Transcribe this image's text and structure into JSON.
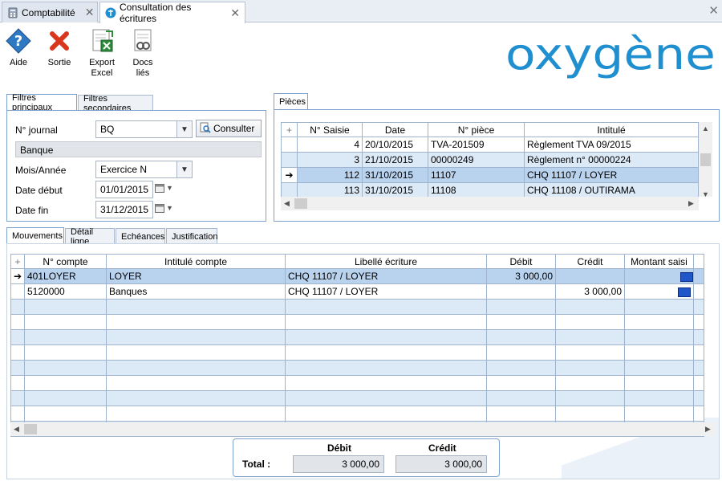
{
  "window_tabs": [
    {
      "label": "Comptabilité",
      "active": false
    },
    {
      "label": "Consultation des écritures",
      "active": true
    }
  ],
  "toolbar": {
    "aide": "Aide",
    "sortie": "Sortie",
    "export_line1": "Export",
    "export_line2": "Excel",
    "docs_line1": "Docs",
    "docs_line2": "liés"
  },
  "logo_text": "oxygène",
  "filters": {
    "tab_main": "Filtres principaux",
    "tab_secondary": "Filtres secondaires",
    "journal_label": "N° journal",
    "journal_value": "BQ",
    "consult_button": "Consulter",
    "journal_name": "Banque",
    "period_label": "Mois/Année",
    "period_value": "Exercice N",
    "start_label": "Date début",
    "start_value": "01/01/2015",
    "end_label": "Date fin",
    "end_value": "31/12/2015"
  },
  "pieces": {
    "tab": "Pièces",
    "headers": [
      "N° Saisie",
      "Date",
      "N° pièce",
      "Intitulé"
    ],
    "rows": [
      {
        "saisie": "4",
        "date": "20/10/2015",
        "piece": "TVA-201509",
        "intitule": "Règlement TVA 09/2015"
      },
      {
        "saisie": "3",
        "date": "21/10/2015",
        "piece": "00000249",
        "intitule": "Règlement n° 00000224"
      },
      {
        "saisie": "112",
        "date": "31/10/2015",
        "piece": "11107",
        "intitule": "CHQ 11107 / LOYER"
      },
      {
        "saisie": "113",
        "date": "31/10/2015",
        "piece": "11108",
        "intitule": "CHQ 11108 / OUTIRAMA"
      }
    ]
  },
  "lower_tabs": [
    "Mouvements",
    "Détail ligne",
    "Echéances",
    "Justification"
  ],
  "mouvements": {
    "headers": [
      "N° compte",
      "Intitulé compte",
      "Libellé écriture",
      "Débit",
      "Crédit",
      "Montant saisi"
    ],
    "rows": [
      {
        "compte": "401LOYER",
        "intitule": "LOYER",
        "libelle": "CHQ 11107 / LOYER",
        "debit": "3 000,00",
        "credit": ""
      },
      {
        "compte": "5120000",
        "intitule": "Banques",
        "libelle": "CHQ 11107 / LOYER",
        "debit": "",
        "credit": "3 000,00"
      }
    ]
  },
  "totals": {
    "debit_header": "Débit",
    "credit_header": "Crédit",
    "label": "Total :",
    "debit": "3 000,00",
    "credit": "3 000,00"
  }
}
